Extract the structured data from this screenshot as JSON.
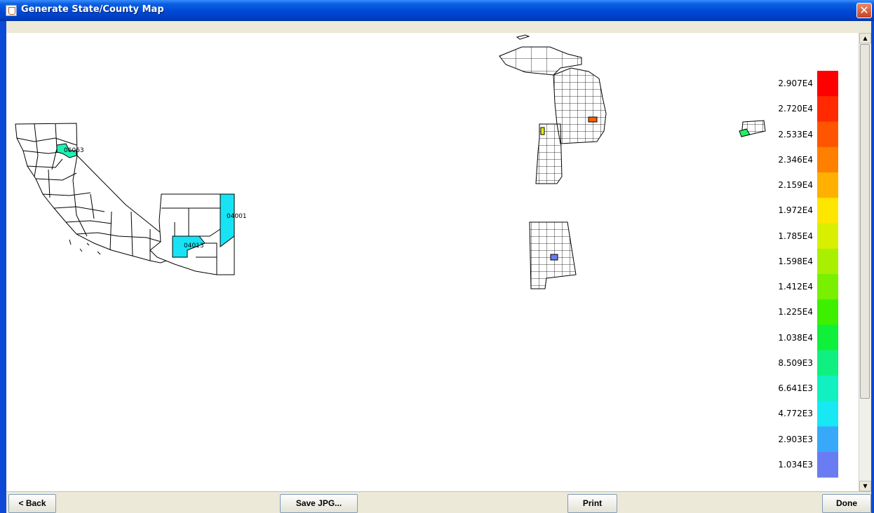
{
  "window": {
    "title": "Generate State/County Map",
    "close_symbol": "✕"
  },
  "map": {
    "county_labels": [
      "06063",
      "04001",
      "04013"
    ],
    "highlight_colors": {
      "cyan": "#17e3f5",
      "teal": "#1ff2b6",
      "orange": "#ff6000",
      "yellow": "#e8f000",
      "blue": "#6a7cf2",
      "green": "#1ff066"
    }
  },
  "legend": {
    "labels": [
      "2.907E4",
      "2.720E4",
      "2.533E4",
      "2.346E4",
      "2.159E4",
      "1.972E4",
      "1.785E4",
      "1.598E4",
      "1.412E4",
      "1.225E4",
      "1.038E4",
      "8.509E3",
      "6.641E3",
      "4.772E3",
      "2.903E3",
      "1.034E3"
    ],
    "colors": [
      "#ff0000",
      "#ff2a00",
      "#ff5500",
      "#ff8000",
      "#ffb000",
      "#ffe600",
      "#d8f000",
      "#a8f000",
      "#78f000",
      "#3cf000",
      "#10f03a",
      "#10f080",
      "#10f0c0",
      "#18e8f4",
      "#38a8f8",
      "#6a7cf2"
    ]
  },
  "buttons": {
    "back": "< Back",
    "save": "Save JPG...",
    "print": "Print",
    "done": "Done"
  }
}
